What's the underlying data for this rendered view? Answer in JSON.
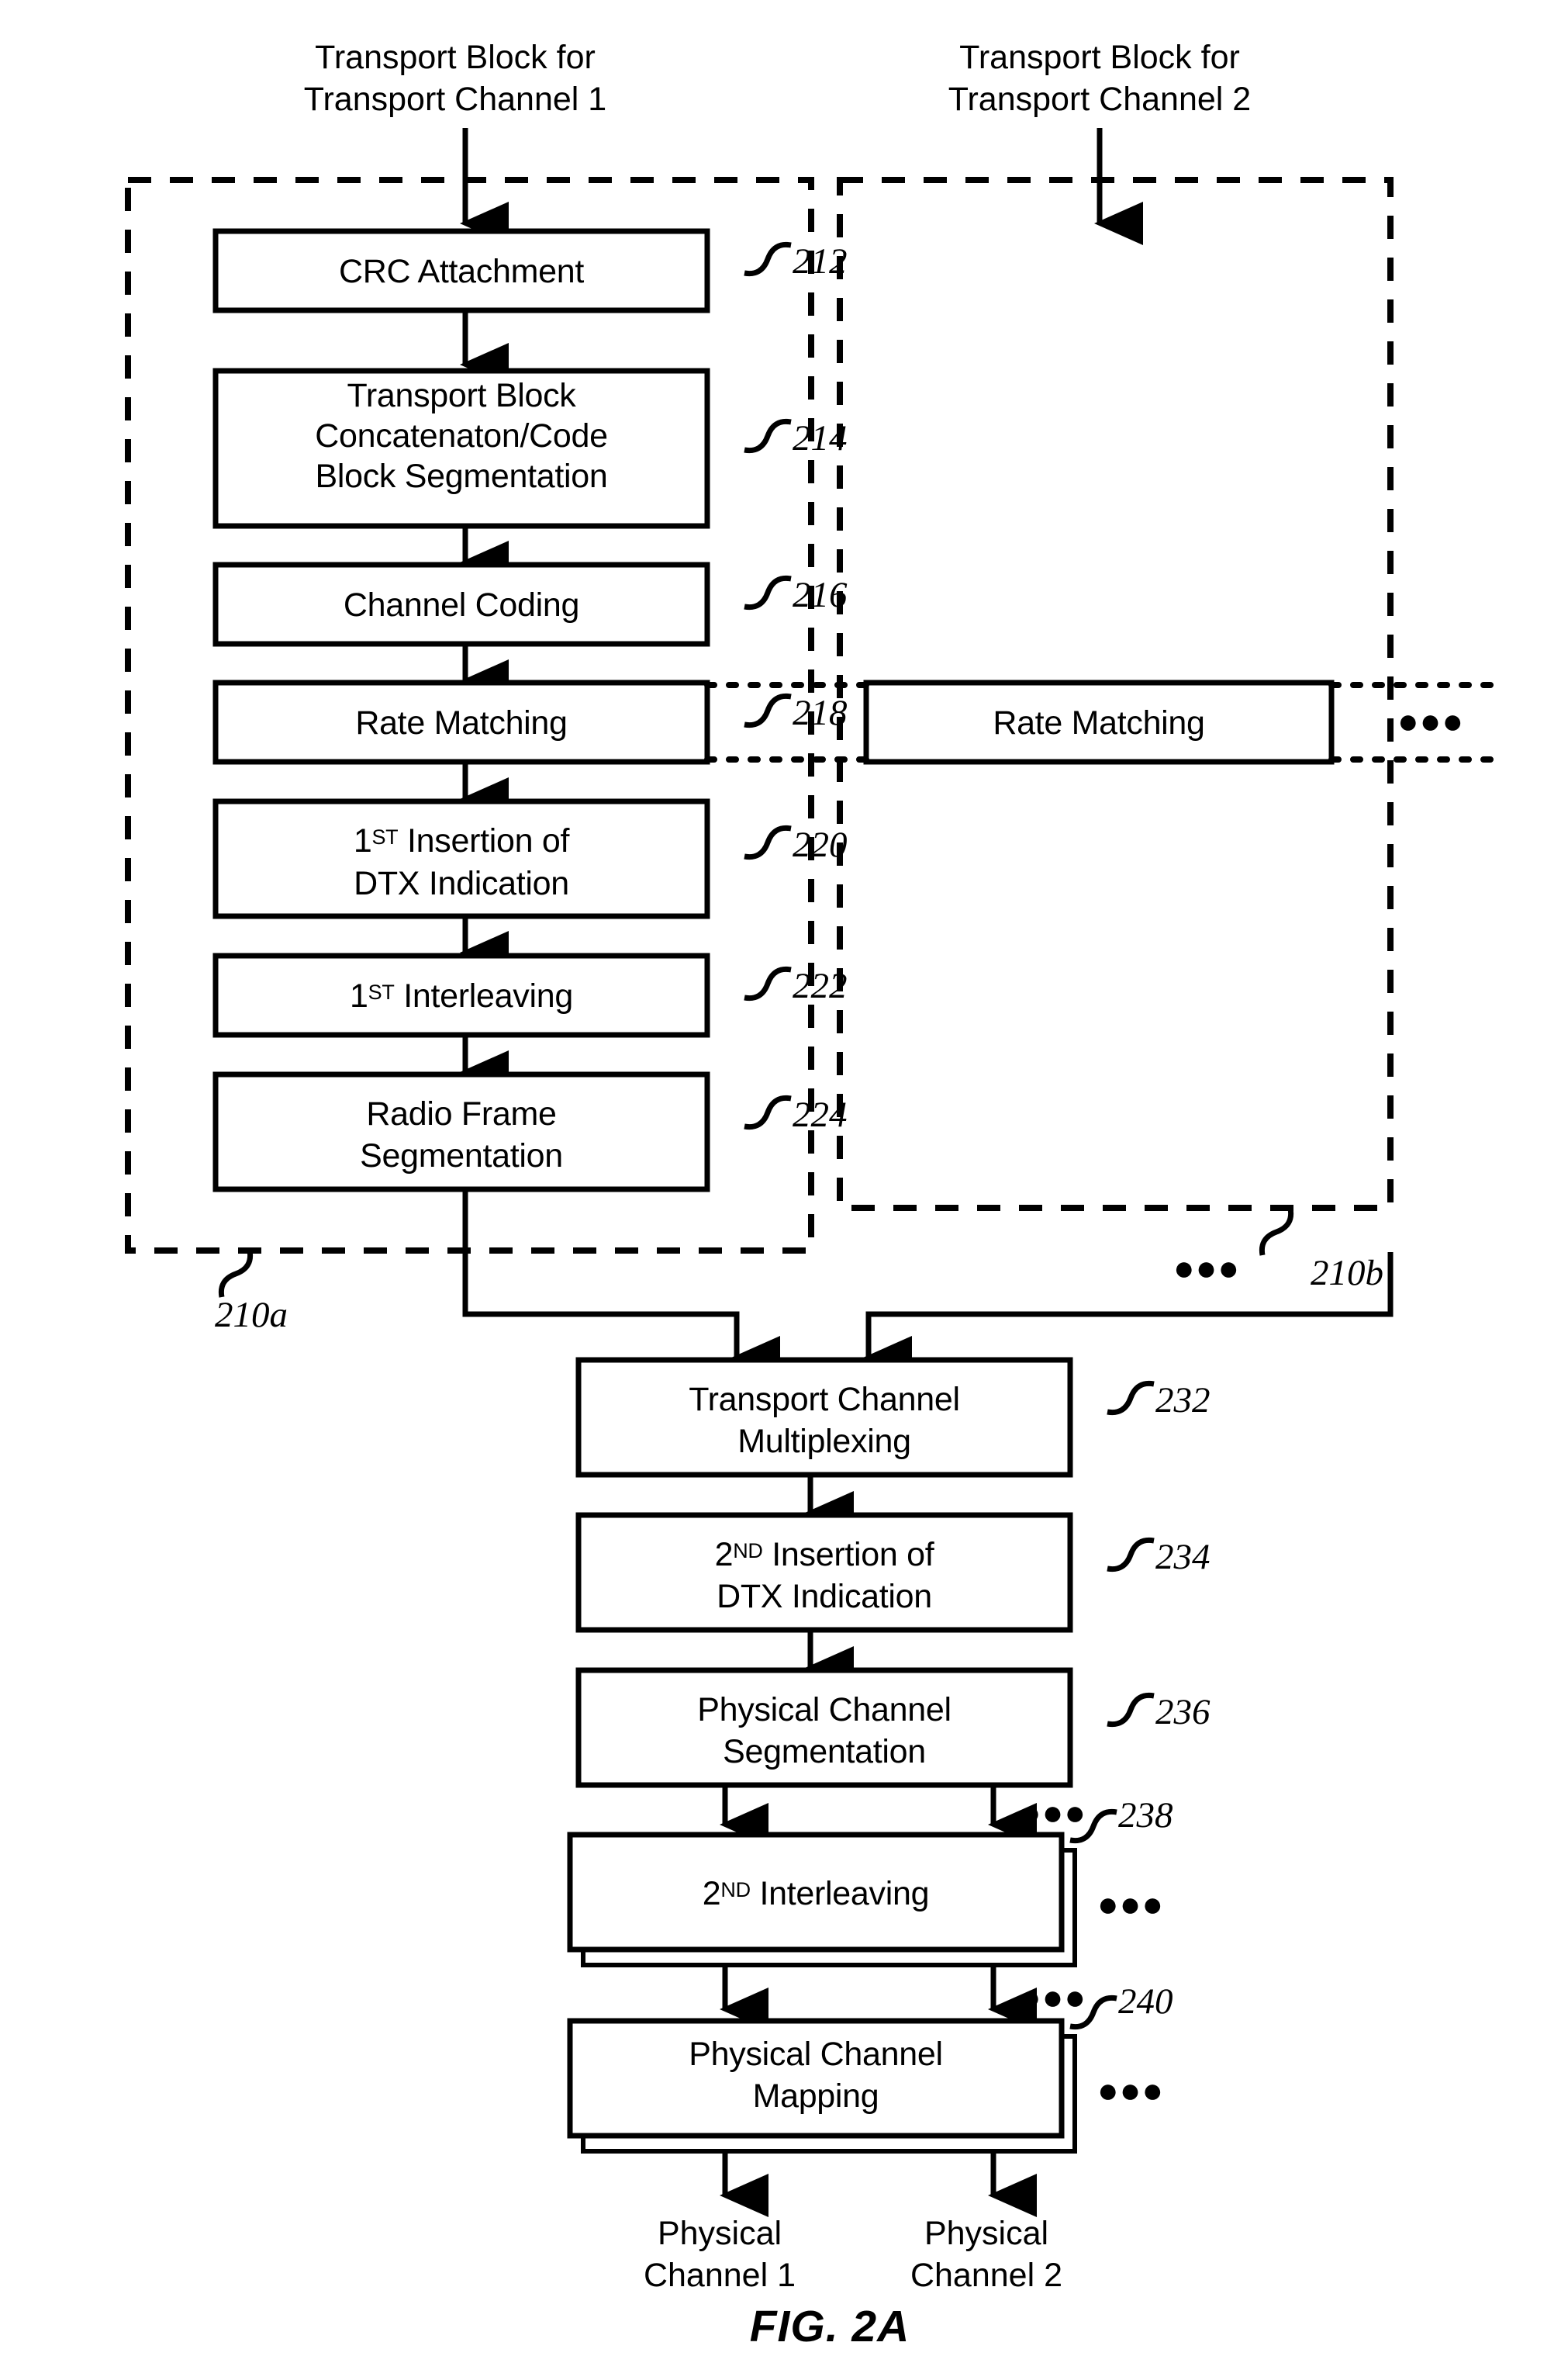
{
  "figure": {
    "caption": "FIG. 2A",
    "inputs": [
      {
        "id": "input-tc1",
        "line1": "Transport Block for",
        "line2": "Transport Channel 1"
      },
      {
        "id": "input-tc2",
        "line1": "Transport Block for",
        "line2": "Transport Channel 2"
      }
    ],
    "outputs": [
      {
        "id": "output-pc1",
        "line1": "Physical",
        "line2": "Channel 1"
      },
      {
        "id": "output-pc2",
        "line1": "Physical",
        "line2": "Channel 2"
      }
    ],
    "groups": [
      {
        "id": "group-210a",
        "ref": "210a"
      },
      {
        "id": "group-210b",
        "ref": "210b"
      }
    ],
    "chain_left": [
      {
        "id": "crc-attachment",
        "ref": "212",
        "lines": [
          "CRC Attachment"
        ]
      },
      {
        "id": "transport-block-concatenation",
        "ref": "214",
        "lines": [
          "Transport Block",
          "Concatenaton/Code",
          "Block Segmentation"
        ]
      },
      {
        "id": "channel-coding",
        "ref": "216",
        "lines": [
          "Channel Coding"
        ]
      },
      {
        "id": "rate-matching-1",
        "ref": "218",
        "lines": [
          "Rate Matching"
        ]
      },
      {
        "id": "first-insertion-dtx",
        "ref": "220",
        "lines": [
          "1ST Insertion of",
          "DTX Indication"
        ],
        "sup": "ST",
        "sup_base": "1"
      },
      {
        "id": "first-interleaving",
        "ref": "222",
        "lines": [
          "1ST Interleaving"
        ],
        "sup": "ST",
        "sup_base": "1"
      },
      {
        "id": "radio-frame-segmentation",
        "ref": "224",
        "lines": [
          "Radio Frame",
          "Segmentation"
        ]
      }
    ],
    "chain_right": [
      {
        "id": "rate-matching-2",
        "ref": "",
        "lines": [
          "Rate Matching"
        ]
      }
    ],
    "chain_bottom": [
      {
        "id": "transport-channel-multiplexing",
        "ref": "232",
        "lines": [
          "Transport Channel",
          "Multiplexing"
        ]
      },
      {
        "id": "second-insertion-dtx",
        "ref": "234",
        "lines": [
          "2ND Insertion of",
          "DTX Indication"
        ],
        "sup": "ND",
        "sup_base": "2"
      },
      {
        "id": "physical-channel-segmentation",
        "ref": "236",
        "lines": [
          "Physical Channel",
          "Segmentation"
        ]
      },
      {
        "id": "second-interleaving",
        "ref": "238",
        "lines": [
          "2ND Interleaving"
        ],
        "sup": "ND",
        "sup_base": "2"
      },
      {
        "id": "physical-channel-mapping",
        "ref": "240",
        "lines": [
          "Physical Channel",
          "Mapping"
        ]
      }
    ],
    "ellipsis": "●●●",
    "colors": {
      "ink": "#000000",
      "paper": "#ffffff"
    },
    "text": {
      "in1_l1": "Transport Block for",
      "in1_l2": "Transport Channel 1",
      "in2_l1": "Transport Block for",
      "in2_l2": "Transport Channel 2",
      "b212": "CRC Attachment",
      "b214_l1": "Transport Block",
      "b214_l2": "Concatenaton/Code",
      "b214_l3": "Block Segmentation",
      "b216": "Channel Coding",
      "b218": "Rate Matching",
      "b220_num": "1",
      "b220_sup": "ST",
      "b220_l1rest": " Insertion of",
      "b220_l2": "DTX Indication",
      "b222_num": "1",
      "b222_sup": "ST",
      "b222_rest": " Interleaving",
      "b224_l1": "Radio Frame",
      "b224_l2": "Segmentation",
      "bRM2": "Rate Matching",
      "b232_l1": "Transport Channel",
      "b232_l2": "Multiplexing",
      "b234_num": "2",
      "b234_sup": "ND",
      "b234_l1rest": " Insertion of",
      "b234_l2": "DTX Indication",
      "b236_l1": "Physical Channel",
      "b236_l2": "Segmentation",
      "b238_num": "2",
      "b238_sup": "ND",
      "b238_rest": " Interleaving",
      "b240_l1": "Physical Channel",
      "b240_l2": "Mapping",
      "out1_l1": "Physical",
      "out1_l2": "Channel 1",
      "out2_l1": "Physical",
      "out2_l2": "Channel 2",
      "ref212": "212",
      "ref214": "214",
      "ref216": "216",
      "ref218": "218",
      "ref220": "220",
      "ref222": "222",
      "ref224": "224",
      "ref232": "232",
      "ref234": "234",
      "ref236": "236",
      "ref238": "238",
      "ref240": "240",
      "ref210a": "210a",
      "ref210b": "210b",
      "dots": "●●●",
      "caption": "FIG. 2A"
    }
  }
}
